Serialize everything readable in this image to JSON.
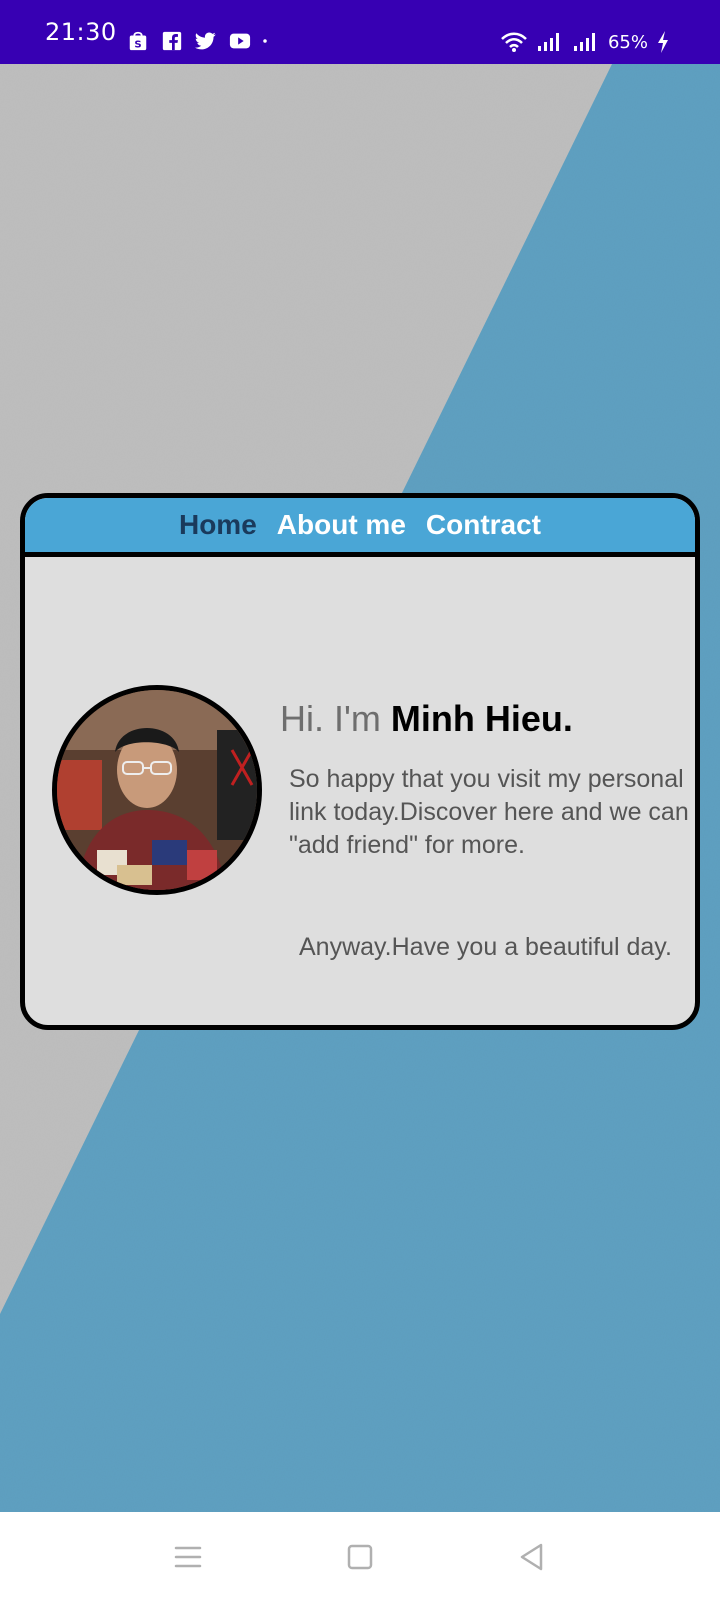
{
  "status_bar": {
    "time": "21:30",
    "notification_icons": [
      "shopee-icon",
      "facebook-icon",
      "twitter-icon",
      "youtube-icon",
      "dot-icon"
    ],
    "battery_percent": "65%"
  },
  "card": {
    "nav": {
      "home": "Home",
      "about": "About me",
      "contract": "Contract"
    },
    "greeting_prefix": "Hi. I'm ",
    "greeting_name": "Minh Hieu.",
    "intro": "So happy that you visit my personal link today.Discover here and we can \"add friend\" for more.",
    "outro": "Anyway.Have you a beautiful day."
  },
  "colors": {
    "status_bar": "#3700b3",
    "card_header": "#4aa6d6",
    "card_body": "#dedede",
    "active_nav": "#1a3a5c",
    "wallpaper_blue": "#4aaee0",
    "wallpaper_gray": "#dcdcdc"
  }
}
